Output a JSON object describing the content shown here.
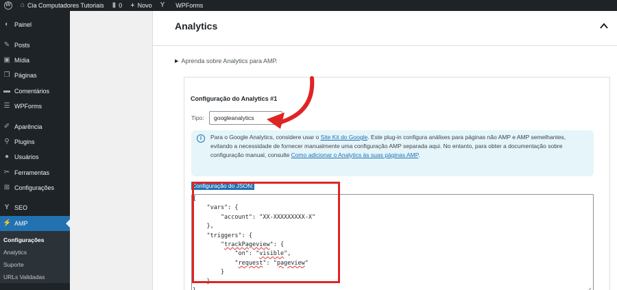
{
  "adminbar": {
    "site_name": "Cia Computadores Tutoriais",
    "comments_count": "0",
    "new_label": "Novo",
    "wpforms_label": "WPForms"
  },
  "sidebar": {
    "items": [
      {
        "label": "Painel",
        "icon": "dashboard-icon"
      },
      {
        "label": "Posts",
        "icon": "pin-icon"
      },
      {
        "label": "Mídia",
        "icon": "media-icon"
      },
      {
        "label": "Páginas",
        "icon": "pages-icon"
      },
      {
        "label": "Comentários",
        "icon": "comments-icon"
      },
      {
        "label": "WPForms",
        "icon": "wpforms-icon"
      },
      {
        "label": "Aparência",
        "icon": "appearance-icon"
      },
      {
        "label": "Plugins",
        "icon": "plugins-icon"
      },
      {
        "label": "Usuários",
        "icon": "users-icon"
      },
      {
        "label": "Ferramentas",
        "icon": "tools-icon"
      },
      {
        "label": "Configurações",
        "icon": "settings-icon"
      },
      {
        "label": "SEO",
        "icon": "seo-icon"
      },
      {
        "label": "AMP",
        "icon": "amp-icon"
      }
    ],
    "submenu": [
      "Configurações",
      "Analytics",
      "Suporte",
      "URLs Validadas"
    ]
  },
  "panel": {
    "title": "Analytics",
    "learn_link": "Aprenda sobre Analytics para AMP.",
    "config_title": "Configuração do Analytics #1",
    "tipo_label": "Tipo:",
    "tipo_value": "googleanalytics",
    "notice": {
      "part1": "Para o Google Analytics, considere usar o ",
      "link1": "Site Kit do Google",
      "part2": ". Este plug-in configura análises para páginas não AMP e AMP semelhantes, evitando a necessidade de fornecer manualmente uma configuração AMP separada aqui. No entanto, para obter a documentação sobre configuração manual, consulte ",
      "link2": "Como adicionar o Analytics às suas páginas AMP",
      "part3": "."
    },
    "json_label": "Configuração do JSON:",
    "json_lines": {
      "l1": "{",
      "l2a": "    \"vars\": {",
      "l3a": "        \"account\": \"XX-XXXXXXXXX-X\"",
      "l4": "    },",
      "l5": "    \"triggers\": {",
      "l6k": "trackPageview",
      "l7k": "\"on\": \"",
      "l7v": "visible",
      "l8k": "request",
      "l8v": "pageview",
      "l9": "        }",
      "l10": "    }",
      "l11": "}"
    }
  },
  "colors": {
    "adminbar_bg": "#1d2327",
    "active_menu": "#2271b1",
    "annotation_red": "#e02424",
    "notice_bg": "#e5f5fa"
  }
}
